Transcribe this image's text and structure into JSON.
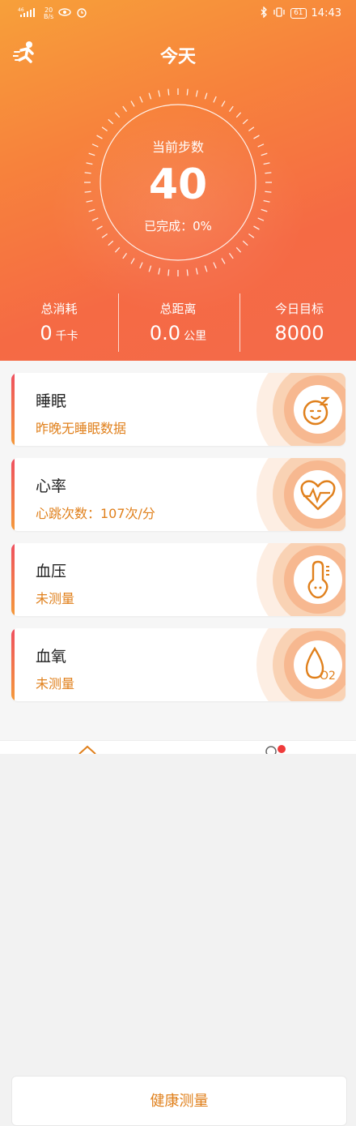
{
  "status_bar": {
    "signal": "46",
    "speed_top": "20",
    "speed_bottom": "B/s",
    "battery": "61",
    "time": "14:43"
  },
  "header": {
    "title": "今天"
  },
  "steps": {
    "label": "当前步数",
    "value": "40",
    "completion": "已完成：0%"
  },
  "stats": {
    "calories_label": "总消耗",
    "calories_value": "0",
    "calories_unit": "千卡",
    "distance_label": "总距离",
    "distance_value": "0.0",
    "distance_unit": "公里",
    "goal_label": "今日目标",
    "goal_value": "8000"
  },
  "cards": [
    {
      "title": "睡眠",
      "subtitle": "昨晚无睡眠数据",
      "icon": "sleep-face-icon"
    },
    {
      "title": "心率",
      "subtitle": "心跳次数：107次/分",
      "icon": "heart-rate-icon"
    },
    {
      "title": "血压",
      "subtitle": "未测量",
      "icon": "thermometer-face-icon"
    },
    {
      "title": "血氧",
      "subtitle": "未测量",
      "icon": "oxygen-drop-icon",
      "icon_text": "O2"
    }
  ],
  "health_button": "健康测量",
  "colors": {
    "accent": "#e0801c",
    "hero_top": "#f7a03a",
    "hero_bottom": "#f46a4a",
    "bar_top": "#ef4f5f",
    "bar_bottom": "#f59a3a"
  }
}
